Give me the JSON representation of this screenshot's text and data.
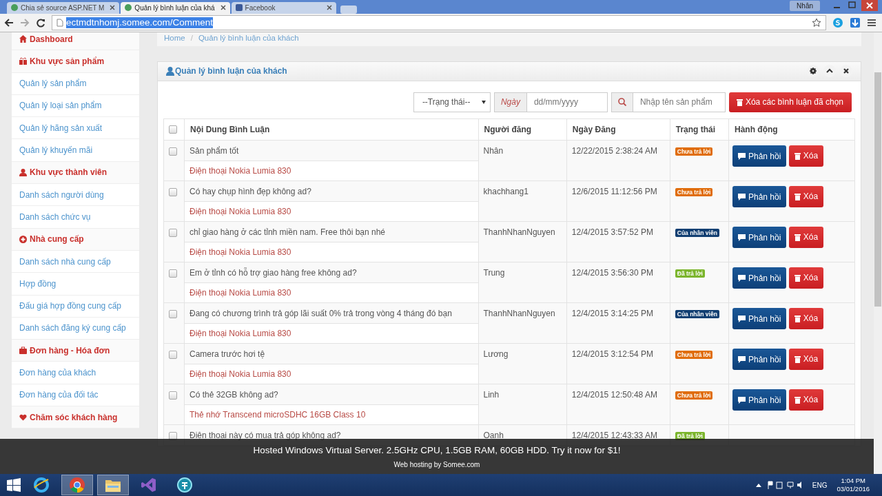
{
  "browser": {
    "tabs": [
      {
        "title": "Chia sẻ source ASP.NET M",
        "selected": false
      },
      {
        "title": "Quản lý bình luận của khá",
        "selected": true
      },
      {
        "title": "Facebook",
        "selected": false
      }
    ],
    "user_badge": "Nhân",
    "url": "ectmdtnhomj.somee.com/Comment"
  },
  "sidebar": {
    "items": [
      {
        "kind": "section",
        "label": "Dashboard"
      },
      {
        "kind": "section",
        "label": "Khu vực sản phẩm"
      },
      {
        "kind": "link",
        "label": "Quản lý sản phẩm"
      },
      {
        "kind": "link",
        "label": "Quản lý loại sản phẩm"
      },
      {
        "kind": "link",
        "label": "Quản lý hãng sản xuất"
      },
      {
        "kind": "link",
        "label": "Quản lý khuyến mãi"
      },
      {
        "kind": "section",
        "label": "Khu vực thành viên"
      },
      {
        "kind": "link",
        "label": "Danh sách người dùng"
      },
      {
        "kind": "link",
        "label": "Danh sách chức vụ"
      },
      {
        "kind": "section",
        "label": "Nhà cung cấp"
      },
      {
        "kind": "link",
        "label": "Danh sách nhà cung cấp"
      },
      {
        "kind": "link",
        "label": "Hợp đồng"
      },
      {
        "kind": "link",
        "label": "Đấu giá hợp đồng cung cấp"
      },
      {
        "kind": "link",
        "label": "Danh sách đăng ký cung cấp"
      },
      {
        "kind": "section",
        "label": "Đơn hàng - Hóa đơn"
      },
      {
        "kind": "link",
        "label": "Đơn hàng của khách"
      },
      {
        "kind": "link",
        "label": "Đơn hàng của đối tác"
      },
      {
        "kind": "section",
        "label": "Chăm sóc khách hàng"
      }
    ]
  },
  "breadcrumb": {
    "items": [
      "Home",
      "Quản lý bình luận của khách"
    ],
    "separator": "/"
  },
  "panel": {
    "title": "Quản lý bình luận của khách",
    "filters": {
      "status": "--Trạng thái--",
      "date_label": "Ngày",
      "date_placeholder": "dd/mm/yyyy",
      "search_placeholder": "Nhập tên sản phẩm",
      "delete_selected": "Xóa các bình luận đã chọn"
    },
    "select_all_checked": false,
    "columns": [
      "Nội Dung Bình Luận",
      "Người đăng",
      "Ngày Đăng",
      "Trạng thái",
      "Hành động"
    ],
    "rows": [
      {
        "checked": false,
        "comment": "Sản phẩm tốt",
        "product": "Điện thoại Nokia Lumia 830",
        "user": "Nhân",
        "date": "12/22/2015 2:38:24 AM",
        "status": {
          "kind": "unanswered",
          "label": "Chưa trả lời"
        },
        "reply": "Phản hồi",
        "delete": "Xóa"
      },
      {
        "checked": false,
        "comment": "Có hay chụp hình đẹp không ad?",
        "product": "Điện thoại Nokia Lumia 830",
        "user": "khachhang1",
        "date": "12/6/2015 11:12:56 PM",
        "status": {
          "kind": "unanswered",
          "label": "Chưa trả lời"
        },
        "reply": "Phản hồi",
        "delete": "Xóa"
      },
      {
        "checked": false,
        "comment": "chỉ giao hàng ở các tỉnh miền nam. Free thôi bạn nhé",
        "product": "Điện thoại Nokia Lumia 830",
        "user": "ThanhNhanNguyen",
        "date": "12/4/2015 3:57:52 PM",
        "status": {
          "kind": "staff",
          "label": "Của nhân viên"
        },
        "reply": "Phản hồi",
        "delete": "Xóa"
      },
      {
        "checked": false,
        "comment": "Em ở tỉnh có hỗ trợ giao hàng free không ad?",
        "product": "Điện thoại Nokia Lumia 830",
        "user": "Trung",
        "date": "12/4/2015 3:56:30 PM",
        "status": {
          "kind": "answered",
          "label": "Đã trả lời"
        },
        "reply": "Phản hồi",
        "delete": "Xóa"
      },
      {
        "checked": false,
        "comment": "Đang có chương trình trả góp lãi suất 0% trả trong vòng 4 tháng đó bạn",
        "product": "Điện thoại Nokia Lumia 830",
        "user": "ThanhNhanNguyen",
        "date": "12/4/2015 3:14:25 PM",
        "status": {
          "kind": "staff",
          "label": "Của nhân viên"
        },
        "reply": "Phản hồi",
        "delete": "Xóa"
      },
      {
        "checked": false,
        "comment": "Camera trước hơi tệ",
        "product": "Điện thoại Nokia Lumia 830",
        "user": "Lương",
        "date": "12/4/2015 3:12:54 PM",
        "status": {
          "kind": "unanswered",
          "label": "Chưa trả lời"
        },
        "reply": "Phản hồi",
        "delete": "Xóa"
      },
      {
        "checked": false,
        "comment": "Có thẻ 32GB không ad?",
        "product": "Thẻ nhớ Transcend microSDHC 16GB Class 10",
        "user": "Linh",
        "date": "12/4/2015 12:50:48 AM",
        "status": {
          "kind": "unanswered",
          "label": "Chưa trả lời"
        },
        "reply": "Phản hồi",
        "delete": "Xóa"
      },
      {
        "checked": false,
        "comment": "Điện thoại này có mua trả góp không ad?",
        "user": "Oanh",
        "date": "12/4/2015 12:43:33 AM",
        "status": {
          "kind": "answered",
          "label": "Đã trả lời"
        }
      }
    ]
  },
  "banner": {
    "text": "Hosted Windows Virtual Server. 2.5GHz CPU, 1.5GB RAM, 60GB HDD. Try it now for $1!",
    "subtext": "Web hosting by Somee.com"
  },
  "taskbar": {
    "language": "ENG",
    "time": "1:04 PM",
    "date": "03/01/2016"
  }
}
